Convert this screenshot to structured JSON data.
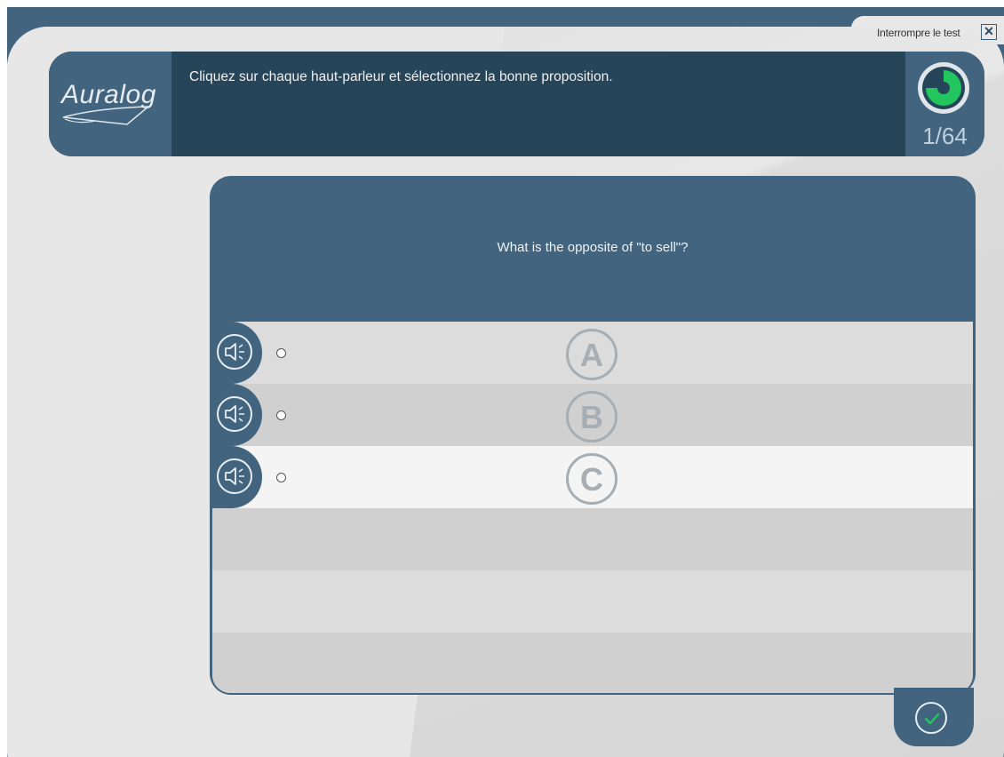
{
  "window": {
    "interrupt_label": "Interrompre le test",
    "close_glyph": "✕"
  },
  "header": {
    "logo": "Auralog",
    "instruction": "Cliquez sur chaque haut-parleur et sélectionnez la bonne proposition.",
    "progress": {
      "current": "1/64",
      "fraction_complete": 0.75
    }
  },
  "question": {
    "text": "What is the opposite of \"to sell\"?",
    "options": [
      {
        "letter": "A",
        "icon": "speaker-icon",
        "selected": false
      },
      {
        "letter": "B",
        "icon": "speaker-icon",
        "selected": false
      },
      {
        "letter": "C",
        "icon": "speaker-icon",
        "selected": false
      }
    ]
  },
  "footer": {
    "validate_icon": "checkmark-icon"
  },
  "colors": {
    "brand_blue": "#42647e",
    "header_dark": "#274559",
    "progress_green": "#22c55e",
    "row_light": "#dcdcdc",
    "row_mid": "#d0d0d0",
    "row_highlight": "#f4f4f4"
  }
}
